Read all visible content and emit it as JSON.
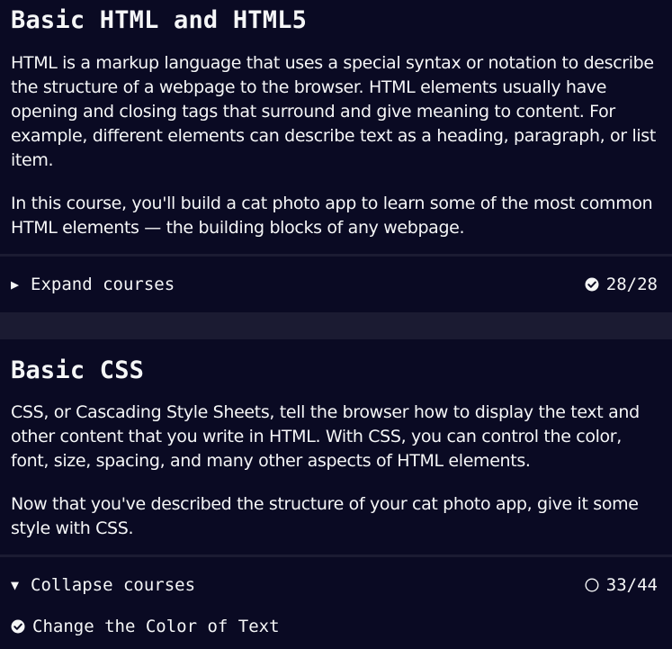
{
  "blocks": [
    {
      "title": "Basic HTML and HTML5",
      "paragraphs": [
        "HTML is a markup language that uses a special syntax or notation to describe the structure of a webpage to the browser. HTML elements usually have opening and closing tags that surround and give meaning to content. For example, different elements can describe text as a heading, paragraph, or list item.",
        "In this course, you'll build a cat photo app to learn some of the most common HTML elements — the building blocks of any webpage."
      ],
      "toggle": {
        "caret": "▶",
        "label": "Expand courses",
        "progress": "28/28",
        "status_icon": "check-circle-icon"
      }
    },
    {
      "title": "Basic CSS",
      "paragraphs": [
        "CSS, or Cascading Style Sheets, tell the browser how to display the text and other content that you write in HTML. With CSS, you can control the color, font, size, spacing, and many other aspects of HTML elements.",
        "Now that you've described the structure of your cat photo app, give it some style with CSS."
      ],
      "toggle": {
        "caret": "▼",
        "label": "Collapse courses",
        "progress": "33/44",
        "status_icon": "empty-circle-icon"
      },
      "courses": [
        {
          "label": "Change the Color of Text",
          "status_icon": "check-circle-icon"
        }
      ]
    }
  ],
  "colors": {
    "background": "#0a0a23",
    "divider": "#1b1b32",
    "text": "#f5f6f7"
  }
}
